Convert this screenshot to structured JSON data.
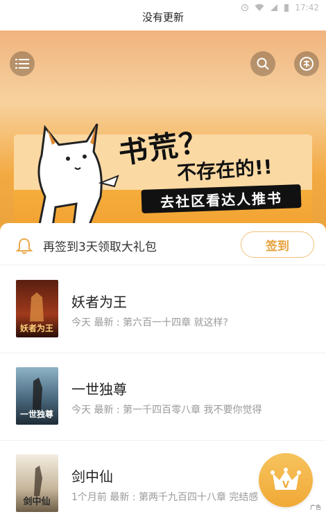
{
  "status": {
    "title": "没有更新",
    "time": "17:42"
  },
  "banner": {
    "headline": "书荒？",
    "subline": "不存在的!!",
    "cta": "去社区看达人推书"
  },
  "signin": {
    "text": "再签到3天领取大礼包",
    "button": "签到"
  },
  "books": [
    {
      "title": "妖者为王",
      "meta": "今天  最新 : 第六百一十四章 就这样?"
    },
    {
      "title": "一世独尊",
      "meta": "今天  最新 : 第一千四百零八章 我不要你觉得"
    },
    {
      "title": "剑中仙",
      "meta": "1个月前  最新 : 第两千九百四十八章 完结感"
    }
  ],
  "vip": {
    "label": "V",
    "ad": "广告"
  }
}
